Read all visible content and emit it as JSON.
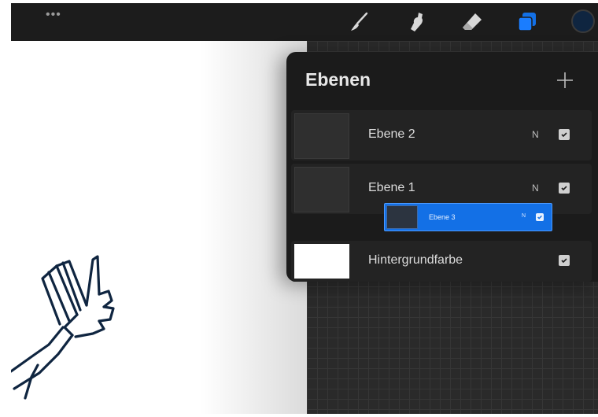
{
  "toolbar": {
    "menu_icon": "more-dots-icon",
    "tools": [
      "brush-icon",
      "smudge-icon",
      "eraser-icon",
      "layers-icon"
    ],
    "active_tool": "layers-icon",
    "accent": "#1370e6",
    "current_color": "#0f2540"
  },
  "layers_panel": {
    "title": "Ebenen",
    "add_label": "+",
    "layers": [
      {
        "name": "Ebene 2",
        "blend": "N",
        "visible": true
      },
      {
        "name": "Ebene 1",
        "blend": "N",
        "visible": true
      }
    ],
    "dragging_layer": {
      "name": "Ebene 3",
      "blend": "N",
      "visible": true
    },
    "background": {
      "name": "Hintergrundfarbe",
      "color": "#ffffff",
      "visible": true
    }
  }
}
